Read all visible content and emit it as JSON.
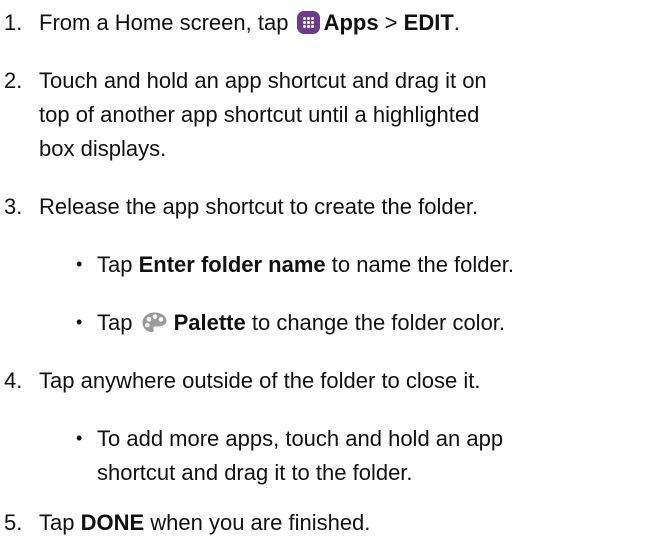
{
  "steps": [
    {
      "num": "1.",
      "lines": [
        {
          "pre": "From a Home screen, tap",
          "icon": "apps-grid-icon",
          "b1": "Apps",
          "mid": " > ",
          "b2": "EDIT",
          "post": "."
        }
      ]
    },
    {
      "num": "2.",
      "lines": [
        "Touch and hold an app shortcut and drag it on",
        "top of another app shortcut until a highlighted",
        "box displays."
      ]
    },
    {
      "num": "3.",
      "lines": [
        "Release the app shortcut to create the folder."
      ],
      "bullets": [
        {
          "pre": "Tap ",
          "bold": "Enter folder name",
          "post": " to name the folder."
        },
        {
          "pre": "Tap ",
          "icon": "palette-icon",
          "bold": "Palette",
          "post": " to change the folder color."
        }
      ]
    },
    {
      "num": "4.",
      "lines": [
        "Tap anywhere outside of the folder to close it."
      ],
      "bullets": [
        {
          "lines": [
            "To add more apps, touch and hold an app",
            "shortcut and drag it to the folder."
          ]
        }
      ]
    },
    {
      "num": "5.",
      "lines": [
        {
          "pre": "Tap ",
          "bold": "DONE",
          "post": " when you are finished."
        }
      ]
    }
  ],
  "bullet_char": "•",
  "colors": {
    "apps_icon": "#6d3d8c",
    "palette_icon": "#9a9a9a",
    "text": "#111111"
  }
}
